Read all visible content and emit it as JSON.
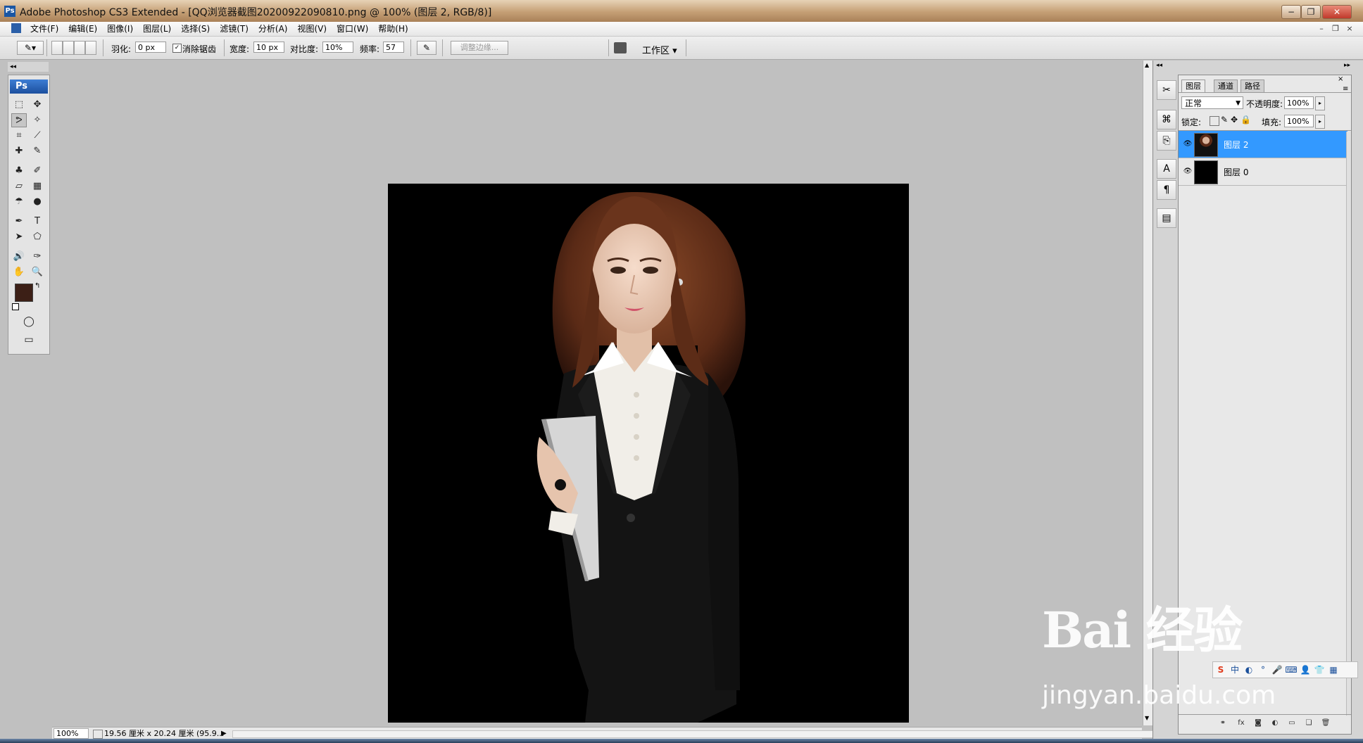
{
  "window": {
    "title": "Adobe Photoshop CS3 Extended - [QQ浏览器截图20200922090810.png @ 100% (图层 2, RGB/8)]",
    "logo_text": "Ps",
    "controls": {
      "minimize": "−",
      "restore": "❐",
      "close": "✕"
    },
    "doc_controls": {
      "minimize": "–",
      "restore": "❐",
      "close": "×"
    }
  },
  "menu": {
    "items": [
      "文件(F)",
      "编辑(E)",
      "图像(I)",
      "图层(L)",
      "选择(S)",
      "滤镜(T)",
      "分析(A)",
      "视图(V)",
      "窗口(W)",
      "帮助(H)"
    ]
  },
  "options": {
    "feather_label": "羽化:",
    "feather_value": "0 px",
    "antialias_label": "消除锯齿",
    "antialias_checked": true,
    "width_label": "宽度:",
    "width_value": "10 px",
    "contrast_label": "对比度:",
    "contrast_value": "10%",
    "frequency_label": "频率:",
    "frequency_value": "57",
    "refine_edge_label": "调整边缘...",
    "workspace_label": "工作区 ▾"
  },
  "toolbox": {
    "logo_text": "Ps",
    "tools": [
      "marquee-tool",
      "move-tool",
      "magnetic-lasso-tool",
      "magic-wand-tool",
      "crop-tool",
      "slice-tool",
      "healing-brush-tool",
      "brush-tool",
      "clone-stamp-tool",
      "history-brush-tool",
      "eraser-tool",
      "gradient-tool",
      "blur-tool",
      "dodge-tool",
      "pen-tool",
      "type-tool",
      "path-selection-tool",
      "shape-tool",
      "notes-tool",
      "eyedropper-tool",
      "hand-tool",
      "zoom-tool"
    ],
    "tool_glyphs": [
      "⬚",
      "✥",
      "ᕗ",
      "✧",
      "⌗",
      "⟋",
      "✚",
      "✎",
      "♣",
      "✐",
      "▱",
      "▦",
      "☂",
      "●",
      "✒",
      "T",
      "➤",
      "⬠",
      "🔊",
      "✑",
      "✋",
      "🔍"
    ],
    "foreground_color": "#3c1f16",
    "background_color": "#ffffff"
  },
  "document": {
    "canvas_bg": "#000000"
  },
  "status": {
    "zoom": "100%",
    "doc_info": "19.56 厘米 x 20.24 厘米 (95.9..."
  },
  "layers_panel": {
    "tabs": [
      "图层",
      "通道",
      "路径"
    ],
    "blend_mode": "正常",
    "opacity_label": "不透明度:",
    "opacity_value": "100%",
    "lock_label": "锁定:",
    "fill_label": "填充:",
    "fill_value": "100%",
    "layers": [
      {
        "name": "图层 2",
        "selected": true
      },
      {
        "name": "图层 0",
        "selected": false
      }
    ],
    "selected_color": "#3399ff"
  },
  "watermark": {
    "logo": "Bai 经验",
    "url": "jingyan.baidu.com"
  }
}
